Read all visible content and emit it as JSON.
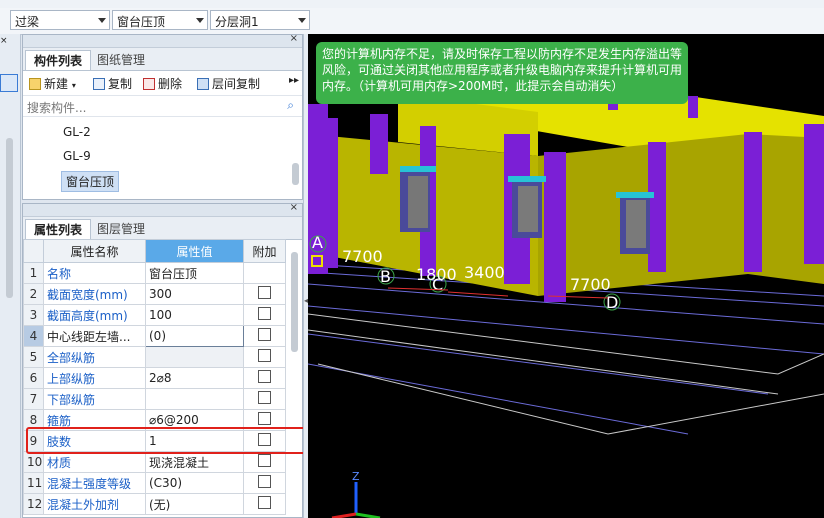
{
  "toolbar": {
    "dropdown1": "过梁",
    "dropdown2": "窗台压顶",
    "dropdown3": "分层洞1"
  },
  "component_panel": {
    "tabs": [
      "构件列表",
      "图纸管理"
    ],
    "actions": {
      "new": "新建",
      "copy": "复制",
      "delete": "删除",
      "floor_copy": "层间复制"
    },
    "search_placeholder": "搜索构件...",
    "items": [
      "GL-2",
      "GL-9",
      "窗台压顶"
    ],
    "selected_index": 2
  },
  "property_panel": {
    "tabs": [
      "属性列表",
      "图层管理"
    ],
    "headers": {
      "name": "属性名称",
      "value": "属性值",
      "extra": "附加"
    },
    "rows": [
      {
        "n": "1",
        "name": "名称",
        "value": "窗台压顶"
      },
      {
        "n": "2",
        "name": "截面宽度(mm)",
        "value": "300"
      },
      {
        "n": "3",
        "name": "截面高度(mm)",
        "value": "100"
      },
      {
        "n": "4",
        "name": "中心线距左墙...",
        "value": "(0)"
      },
      {
        "n": "5",
        "name": "全部纵筋",
        "value": ""
      },
      {
        "n": "6",
        "name": "上部纵筋",
        "value": "2⌀8"
      },
      {
        "n": "7",
        "name": "下部纵筋",
        "value": ""
      },
      {
        "n": "8",
        "name": "箍筋",
        "value": "⌀6@200"
      },
      {
        "n": "9",
        "name": "肢数",
        "value": "1"
      },
      {
        "n": "10",
        "name": "材质",
        "value": "现浇混凝土"
      },
      {
        "n": "11",
        "name": "混凝土强度等级",
        "value": "(C30)"
      },
      {
        "n": "12",
        "name": "混凝土外加剂",
        "value": "(无)"
      }
    ]
  },
  "viewport": {
    "notice": "您的计算机内存不足，请及时保存工程以防内存不足发生内存溢出等风险，可通过关闭其他应用程序或者升级电脑内存来提升计算机可用内存。（计算机可用内存>200M时，此提示会自动消失）",
    "axis_labels": [
      "A",
      "B",
      "C",
      "D"
    ],
    "dimensions": [
      "7700",
      "1800",
      "3400",
      "7700"
    ],
    "axis_z": "Z"
  },
  "colors": {
    "accent": "#5aa9e8",
    "notice_bg": "#3cb14a",
    "highlight_box": "#e0211b",
    "wall_yellow": "#d8d400",
    "column_purple": "#7b1fd6"
  }
}
